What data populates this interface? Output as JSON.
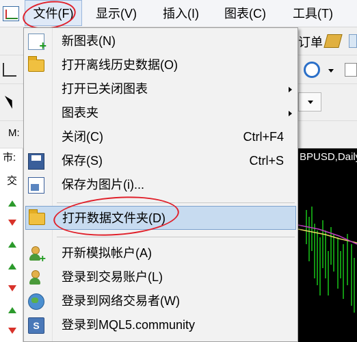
{
  "menubar": {
    "items": [
      "文件(F)",
      "显示(V)",
      "插入(I)",
      "图表(C)",
      "工具(T)"
    ]
  },
  "background": {
    "toolbar_text": "订单",
    "panel_label_1": "M:",
    "panel_tab": "市:",
    "panel_tab_2": "交",
    "chart_title": "BPUSD,Daily"
  },
  "file_menu": {
    "items": [
      {
        "label": "新图表(N)",
        "icon": "new-chart-icon"
      },
      {
        "label": "打开离线历史数据(O)",
        "icon": "folder-icon"
      },
      {
        "label": "打开已关闭图表",
        "submenu": true
      },
      {
        "label": "图表夹",
        "submenu": true
      },
      {
        "label": "关闭(C)",
        "shortcut": "Ctrl+F4"
      },
      {
        "label": "保存(S)",
        "shortcut": "Ctrl+S",
        "icon": "save-icon"
      },
      {
        "label": "保存为图片(i)...",
        "icon": "save-image-icon"
      },
      {
        "label": "打开数据文件夹(D)",
        "icon": "folder-icon",
        "highlighted": true
      },
      {
        "label": "开新模拟帐户(A)",
        "icon": "add-user-icon"
      },
      {
        "label": "登录到交易账户(L)",
        "icon": "login-user-icon"
      },
      {
        "label": "登录到网络交易者(W)",
        "icon": "globe-icon"
      },
      {
        "label": "登录到MQL5.community",
        "icon": "mql5-icon"
      }
    ]
  },
  "colors": {
    "highlight": "#c7dbf0",
    "annotation": "#e0202a",
    "chart_background": "#000000"
  }
}
